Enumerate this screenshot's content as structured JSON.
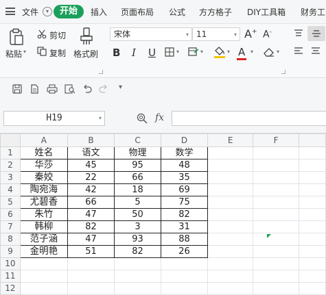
{
  "menubar": {
    "file_label": "文件",
    "active_tab": "开始",
    "tabs": [
      "插入",
      "页面布局",
      "公式",
      "方方格子",
      "DIY工具箱",
      "财务工"
    ]
  },
  "ribbon": {
    "paste_label": "粘贴",
    "cut_label": "剪切",
    "copy_label": "复制",
    "format_painter_label": "格式刷",
    "font_name": "宋体",
    "font_size": "11",
    "bold_label": "B",
    "italic_label": "I",
    "underline_label": "U",
    "grow_label": "A",
    "shrink_label": "A",
    "font_color_label": "A",
    "font_color": "#e02020",
    "fill_color": "#f5c400"
  },
  "formula_bar": {
    "cell_ref": "H19",
    "fx_label": "fx",
    "formula": ""
  },
  "sheet": {
    "columns": [
      "A",
      "B",
      "C",
      "D",
      "E",
      "F"
    ],
    "row_numbers": [
      "1",
      "2",
      "3",
      "4",
      "5",
      "6",
      "7",
      "8",
      "9",
      "10",
      "11",
      "12"
    ],
    "rows": [
      [
        "姓名",
        "语文",
        "物理",
        "数学"
      ],
      [
        "华莎",
        "45",
        "95",
        "48"
      ],
      [
        "秦姣",
        "22",
        "66",
        "35"
      ],
      [
        "陶宛海",
        "42",
        "18",
        "69"
      ],
      [
        "尤碧香",
        "66",
        "5",
        "75"
      ],
      [
        "朱竹",
        "47",
        "50",
        "82"
      ],
      [
        "韩柳",
        "82",
        "3",
        "31"
      ],
      [
        "范子涵",
        "47",
        "93",
        "88"
      ],
      [
        "金明艳",
        "51",
        "82",
        "26"
      ]
    ]
  },
  "colors": {
    "accent": "#1aa05a"
  }
}
